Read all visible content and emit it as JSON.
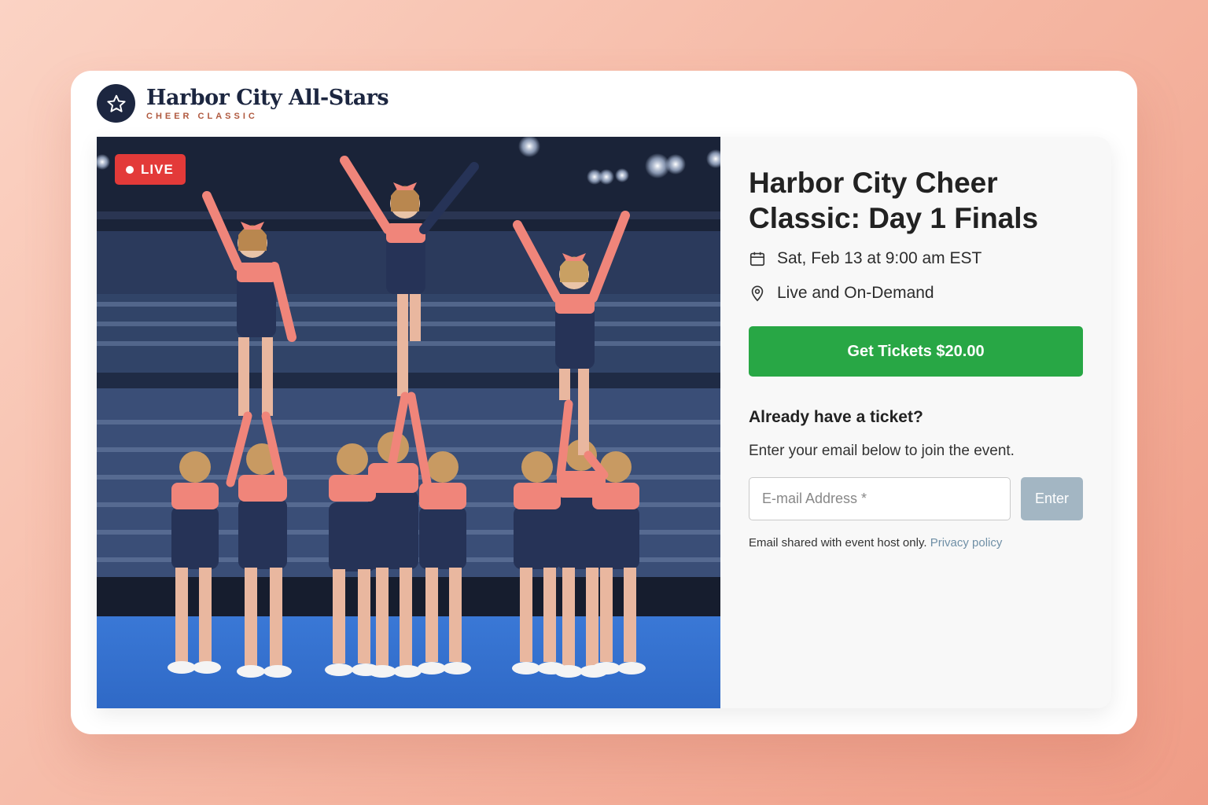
{
  "brand": {
    "name": "Harbor City All-Stars",
    "subtitle": "CHEER CLASSIC",
    "logo_icon": "star-icon"
  },
  "hero": {
    "live_label": "LIVE",
    "image_description": "cheer-team-pyramid-photo"
  },
  "event": {
    "title": "Harbor City Cheer Classic: Day 1 Finals",
    "date": "Sat, Feb 13 at 9:00 am EST",
    "location": "Live and On-Demand",
    "date_icon": "calendar-icon",
    "location_icon": "map-pin-icon"
  },
  "tickets": {
    "button_label": "Get Tickets $20.00",
    "accent_color": "#28a745"
  },
  "access": {
    "heading": "Already have a ticket?",
    "instructions": "Enter your email below to join the event.",
    "email_placeholder": "E-mail Address *",
    "enter_label": "Enter",
    "footnote": "Email shared with event host only.",
    "privacy_link": "Privacy policy"
  },
  "colors": {
    "live_badge": "#e33a39",
    "brand_navy": "#1c2640",
    "brand_accent": "#b0593f",
    "enter_disabled": "#a3b6c3"
  }
}
